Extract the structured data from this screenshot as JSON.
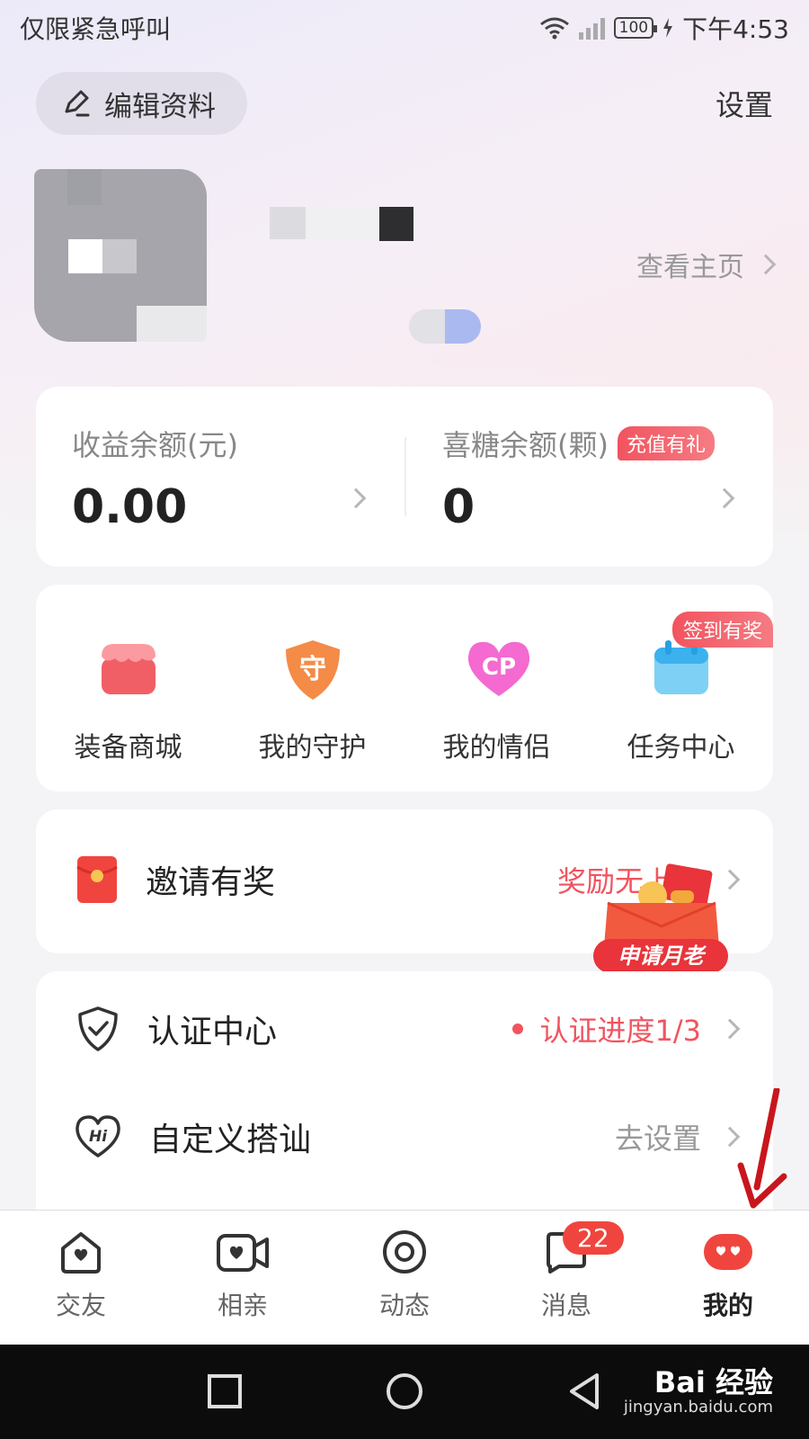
{
  "status_bar": {
    "left_text": "仅限紧急呼叫",
    "battery": "100",
    "time": "下午4:53"
  },
  "header": {
    "edit_label": "编辑资料",
    "settings_label": "设置"
  },
  "profile": {
    "view_home_label": "查看主页"
  },
  "balance": {
    "income_label": "收益余额(元)",
    "income_value": "0.00",
    "candy_label": "喜糖余额(颗)",
    "candy_badge": "充值有礼",
    "candy_value": "0"
  },
  "features": {
    "sign_badge": "签到有奖",
    "items": [
      {
        "label": "装备商城",
        "icon": "shop-icon"
      },
      {
        "label": "我的守护",
        "icon": "shield-guard-icon"
      },
      {
        "label": "我的情侣",
        "icon": "cp-heart-icon"
      },
      {
        "label": "任务中心",
        "icon": "calendar-icon"
      }
    ]
  },
  "invite": {
    "label": "邀请有奖",
    "reward_text": "奖励无上限",
    "promo_text": "申请月老"
  },
  "list": {
    "items": [
      {
        "label": "认证中心",
        "right": "认证进度1/3",
        "icon": "shield-check-icon"
      },
      {
        "label": "自定义搭讪",
        "right": "去设置",
        "icon": "hi-heart-icon"
      }
    ]
  },
  "bottom_nav": {
    "items": [
      {
        "label": "交友",
        "icon": "home-heart-icon"
      },
      {
        "label": "相亲",
        "icon": "video-icon"
      },
      {
        "label": "动态",
        "icon": "target-icon"
      },
      {
        "label": "消息",
        "icon": "message-icon"
      },
      {
        "label": "我的",
        "icon": "profile-icon"
      }
    ],
    "message_badge": "22"
  },
  "watermark": {
    "brand": "Bai 经验",
    "url": "jingyan.baidu.com"
  },
  "colors": {
    "accent_red": "#f1545f",
    "badge_red": "#f0453e"
  }
}
